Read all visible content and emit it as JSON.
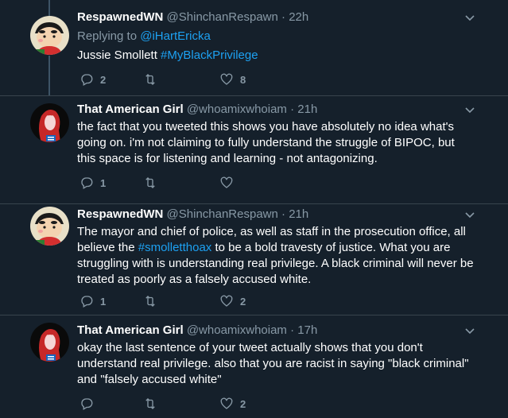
{
  "tweets": [
    {
      "name": "RespawnedWN",
      "handle": "@ShinchanRespawn",
      "time": "22h",
      "replying_prefix": "Replying to ",
      "replying_to": "@iHartEricka",
      "text_parts": [
        "Jussie Smollett ",
        "#MyBlackPrivilege"
      ],
      "replies": "2",
      "retweets": "",
      "likes": "8",
      "avatar": "shinchan"
    },
    {
      "name": "That American Girl",
      "handle": "@whoamixwhoiam",
      "time": "21h",
      "text": "the fact that you tweeted this shows you have absolutely no idea what's going on. i'm not claiming to fully understand the struggle of BIPOC, but this space is for listening and learning - not antagonizing.",
      "replies": "1",
      "retweets": "",
      "likes": "",
      "avatar": "girl"
    },
    {
      "name": "RespawnedWN",
      "handle": "@ShinchanRespawn",
      "time": "21h",
      "text_parts": [
        "The mayor and chief of police, as well as staff in the prosecution office, all believe the ",
        "#smolletthoax",
        " to be a bold travesty of justice. What you are struggling with is understanding real privilege. A black criminal will never be treated as poorly as a falsely accused white."
      ],
      "replies": "1",
      "retweets": "",
      "likes": "2",
      "avatar": "shinchan"
    },
    {
      "name": "That American Girl",
      "handle": "@whoamixwhoiam",
      "time": "17h",
      "text": "okay the last sentence of your tweet actually shows that you don't understand real privilege. also that you are racist in saying \"black criminal\" and \"falsely accused white\"",
      "replies": "",
      "retweets": "",
      "likes": "2",
      "avatar": "girl"
    }
  ],
  "separator": " · ",
  "icons": {
    "reply": "reply-icon",
    "retweet": "retweet-icon",
    "like": "heart-icon",
    "more": "chevron-down-icon"
  },
  "colors": {
    "background": "#15202b",
    "muted": "#8899a6",
    "link": "#1da1f2",
    "divider": "#38444d",
    "thread": "#3d5466"
  }
}
